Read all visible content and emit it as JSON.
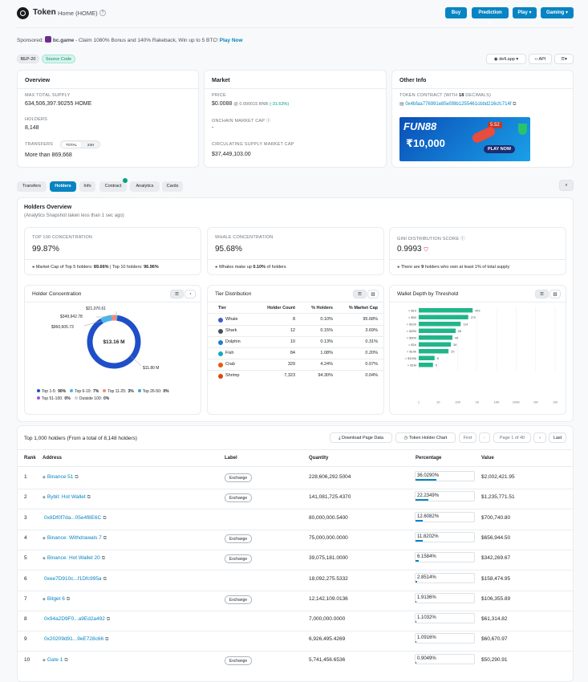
{
  "header": {
    "title": "Token",
    "subtitle": "Home (HOME)",
    "help": "?",
    "nav": [
      "Buy",
      "Prediction",
      "Play",
      "Gaming"
    ]
  },
  "sponsor": {
    "prefix": "Sponsored:",
    "brand": "bc.game",
    "text": "- Claim 1080% Bonus and 140% Rakeback, Win up to 5 BTC!",
    "cta": "Play Now"
  },
  "tags": [
    "BEP-20",
    "Source Code"
  ],
  "right_controls": {
    "app": "defi.app",
    "api": "API"
  },
  "overview": {
    "title": "Overview",
    "max_supply_label": "MAX TOTAL SUPPLY",
    "max_supply": "634,506,397.90255 HOME",
    "holders_label": "HOLDERS",
    "holders": "8,148",
    "transfers_label": "TRANSFERS",
    "transfer_tabs": [
      "TOTAL",
      "24H"
    ],
    "transfers": "More than 869,668"
  },
  "market": {
    "title": "Market",
    "price_label": "PRICE",
    "price": "$0.0088",
    "price_bnb": "@ 0.000015 BNB",
    "price_change": "(-31.63%)",
    "onchain_label": "ONCHAIN MARKET CAP",
    "onchain_value": "-",
    "circ_label": "CIRCULATING SUPPLY MARKET CAP",
    "circ_value": "$37,449,103.00"
  },
  "other": {
    "title": "Other Info",
    "contract_label": "TOKEN CONTRACT (WITH",
    "contract_decimals": "18",
    "contract_label_end": "DECIMALS)",
    "contract": "0x4bfaa776991e85e5f8b1255461cbbd216cfc714f",
    "ad_brand": "FUN88",
    "ad_amount": "₹10,000",
    "ad_cta": "PLAY NOW",
    "ad_odds": "5.52"
  },
  "tabs": [
    "Transfers",
    "Holders",
    "Info",
    "Contract",
    "Analytics",
    "Cards"
  ],
  "holders_overview": {
    "title": "Holders Overview",
    "subtitle": "(Analytics Snapshot taken less than 1 sec ago)",
    "top100_label": "TOP 100 CONCENTRATION",
    "top100": "99.87%",
    "top100_note_a": "Market Cap of Top 5 holders:",
    "top100_note_b": "89.66%",
    "top100_note_c": "| Top 10 holders:",
    "top100_note_d": "96.96%",
    "whale_label": "WHALE CONCENTRATION",
    "whale": "95.68%",
    "whale_note_a": "Whales make up",
    "whale_note_b": "0.10%",
    "whale_note_c": "of holders",
    "gini_label": "GINI DISTRIBUTION SCORE",
    "gini": "0.9993",
    "gini_note_a": "There are",
    "gini_note_b": "9",
    "gini_note_c": "holders who own at least 1% of total supply"
  },
  "concentration": {
    "title": "Holder Concentration",
    "center": "$13.16 M",
    "slices": [
      {
        "label": "Top 1-5:",
        "pct": 90,
        "pct_text": "90%",
        "color": "#1f4fc8",
        "value": "$11.80 M"
      },
      {
        "label": "Top 6-10:",
        "pct": 7,
        "pct_text": "7%",
        "color": "#4ab6ea",
        "value": "$960,605.73"
      },
      {
        "label": "Top 11-25:",
        "pct": 3,
        "pct_text": "3%",
        "color": "#f08a7a",
        "value": "$349,942.78"
      },
      {
        "label": "Top 26-50:",
        "pct": 0,
        "pct_text": "0%",
        "color": "#3fa7d6",
        "value": "$21,070.61"
      },
      {
        "label": "Top 51-100:",
        "pct": 0,
        "pct_text": "0%",
        "color": "#9b59d0",
        "value": ""
      },
      {
        "label": "Outside 100:",
        "pct": 0,
        "pct_text": "0%",
        "color": "#d0d0d0",
        "value": ""
      }
    ]
  },
  "tier": {
    "title": "Tier Distribution",
    "headers": [
      "Tier",
      "Holder Count",
      "% Holders",
      "% Market Cap"
    ],
    "rows": [
      [
        "Whale",
        "8",
        "0.10%",
        "95.68%"
      ],
      [
        "Shark",
        "12",
        "0.15%",
        "3.69%"
      ],
      [
        "Dolphin",
        "10",
        "0.13%",
        "0.31%"
      ],
      [
        "Fish",
        "84",
        "1.08%",
        "0.20%"
      ],
      [
        "Crab",
        "329",
        "4.24%",
        "0.07%"
      ],
      [
        "Shrimp",
        "7,323",
        "94.30%",
        "0.04%"
      ]
    ]
  },
  "chart_data": {
    "type": "bar",
    "title": "Wallet Depth by Threshold",
    "categories": [
      "> $10",
      "> $50",
      "> $100",
      "> $250",
      "> $500",
      "> $1k",
      "> $10k",
      "> $100k",
      "> $1M"
    ],
    "values": [
      443,
      270,
      114,
      65,
      45,
      38,
      29,
      6,
      5
    ],
    "x_ticks": [
      "1",
      "10",
      "100",
      "1K",
      "10K",
      "100K",
      "1M",
      "1M"
    ],
    "color": "#20b58a"
  },
  "holders_table": {
    "title": "Top 1,000 holders (From a total of 8,148 holders)",
    "download": "Download Page Data",
    "chart_btn": "Token Holder Chart",
    "first": "First",
    "page": "Page 1 of 40",
    "last": "Last",
    "headers": [
      "Rank",
      "Address",
      "Label",
      "Quantity",
      "Percentage",
      "Value"
    ],
    "rows": [
      {
        "rank": "1",
        "addr": "Binance 51",
        "label": "Exchange",
        "qty": "228,606,292.5004",
        "pct": "36.0290%",
        "p": 36.03,
        "val": "$2,002,421.95"
      },
      {
        "rank": "2",
        "addr": "Bybit: Hot Wallet",
        "label": "Exchange",
        "qty": "141,081,725.4370",
        "pct": "22.2349%",
        "p": 22.23,
        "val": "$1,235,771.51"
      },
      {
        "rank": "3",
        "addr": "0x8Df0f7da...05e4f8E6C",
        "label": "",
        "qty": "80,000,000.5400",
        "pct": "12.6082%",
        "p": 12.61,
        "val": "$700,740.80"
      },
      {
        "rank": "4",
        "addr": "Binance: Withdrawals 7",
        "label": "Exchange",
        "qty": "75,000,000.0000",
        "pct": "11.8202%",
        "p": 11.82,
        "val": "$656,944.50"
      },
      {
        "rank": "5",
        "addr": "Binance: Hot Wallet 20",
        "label": "Exchange",
        "qty": "39,075,181.0000",
        "pct": "6.1584%",
        "p": 6.16,
        "val": "$342,269.67"
      },
      {
        "rank": "6",
        "addr": "0xee7D910c...f1Dfc995a",
        "label": "",
        "qty": "18,092,275.5332",
        "pct": "2.8514%",
        "p": 2.85,
        "val": "$158,474.95"
      },
      {
        "rank": "7",
        "addr": "Bitget 6",
        "label": "Exchange",
        "qty": "12,142,109.0136",
        "pct": "1.9136%",
        "p": 1.91,
        "val": "$106,355.89"
      },
      {
        "rank": "8",
        "addr": "0x94a2D9F0...a9Ed2a492",
        "label": "",
        "qty": "7,000,000.0000",
        "pct": "1.1032%",
        "p": 1.1,
        "val": "$61,314.82"
      },
      {
        "rank": "9",
        "addr": "0x20209d91...9eE728c66",
        "label": "",
        "qty": "6,926,495.4269",
        "pct": "1.0916%",
        "p": 1.09,
        "val": "$60,670.97"
      },
      {
        "rank": "10",
        "addr": "Gate 1",
        "label": "Exchange",
        "qty": "5,741,456.6536",
        "pct": "0.9049%",
        "p": 0.9,
        "val": "$50,290.91"
      }
    ]
  }
}
